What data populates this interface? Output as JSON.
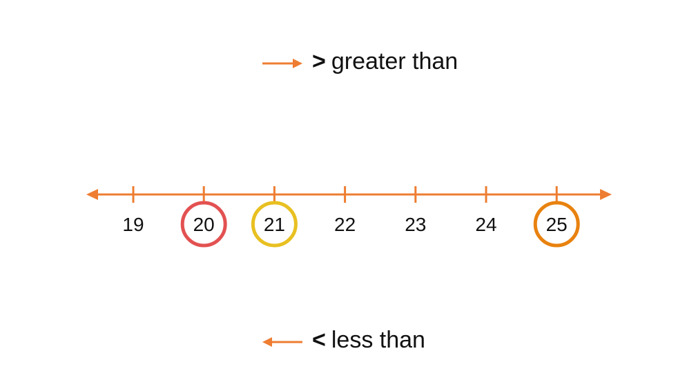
{
  "legend": {
    "greater": {
      "symbol": ">",
      "label": "greater than",
      "arrow": "right-arrow-icon"
    },
    "less": {
      "symbol": "<",
      "label": "less than",
      "arrow": "left-arrow-icon"
    }
  },
  "colors": {
    "line": "#ee7d31",
    "circle_20": "#e35151",
    "circle_21": "#e8c021",
    "circle_25": "#e8820f"
  },
  "number_line": {
    "ticks": [
      19,
      20,
      21,
      22,
      23,
      24,
      25
    ],
    "circled": [
      {
        "value": 20,
        "color": "#e35151"
      },
      {
        "value": 21,
        "color": "#e8c021"
      },
      {
        "value": 25,
        "color": "#e8820f"
      }
    ]
  }
}
